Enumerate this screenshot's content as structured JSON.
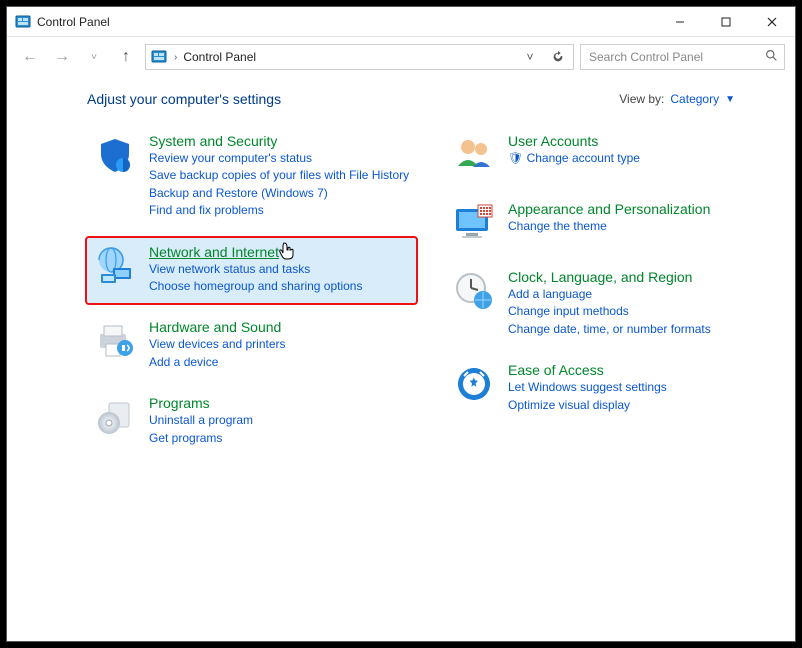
{
  "window": {
    "title": "Control Panel"
  },
  "breadcrumb": {
    "root": "Control Panel",
    "sep": "›"
  },
  "search": {
    "placeholder": "Search Control Panel"
  },
  "heading": "Adjust your computer's settings",
  "viewby": {
    "label": "View by:",
    "value": "Category"
  },
  "left": [
    {
      "id": "system-security",
      "title": "System and Security",
      "subs": [
        "Review your computer's status",
        "Save backup copies of your files with File History",
        "Backup and Restore (Windows 7)",
        "Find and fix problems"
      ]
    },
    {
      "id": "network-internet",
      "title": "Network and Internet",
      "subs": [
        "View network status and tasks",
        "Choose homegroup and sharing options"
      ],
      "highlight": true
    },
    {
      "id": "hardware-sound",
      "title": "Hardware and Sound",
      "subs": [
        "View devices and printers",
        "Add a device"
      ]
    },
    {
      "id": "programs",
      "title": "Programs",
      "subs": [
        "Uninstall a program",
        "Get programs"
      ]
    }
  ],
  "right": [
    {
      "id": "user-accounts",
      "title": "User Accounts",
      "subs": [
        "🛡 Change account type"
      ]
    },
    {
      "id": "appearance-personalization",
      "title": "Appearance and Personalization",
      "subs": [
        "Change the theme"
      ]
    },
    {
      "id": "clock-language-region",
      "title": "Clock, Language, and Region",
      "subs": [
        "Add a language",
        "Change input methods",
        "Change date, time, or number formats"
      ]
    },
    {
      "id": "ease-of-access",
      "title": "Ease of Access",
      "subs": [
        "Let Windows suggest settings",
        "Optimize visual display"
      ]
    }
  ]
}
